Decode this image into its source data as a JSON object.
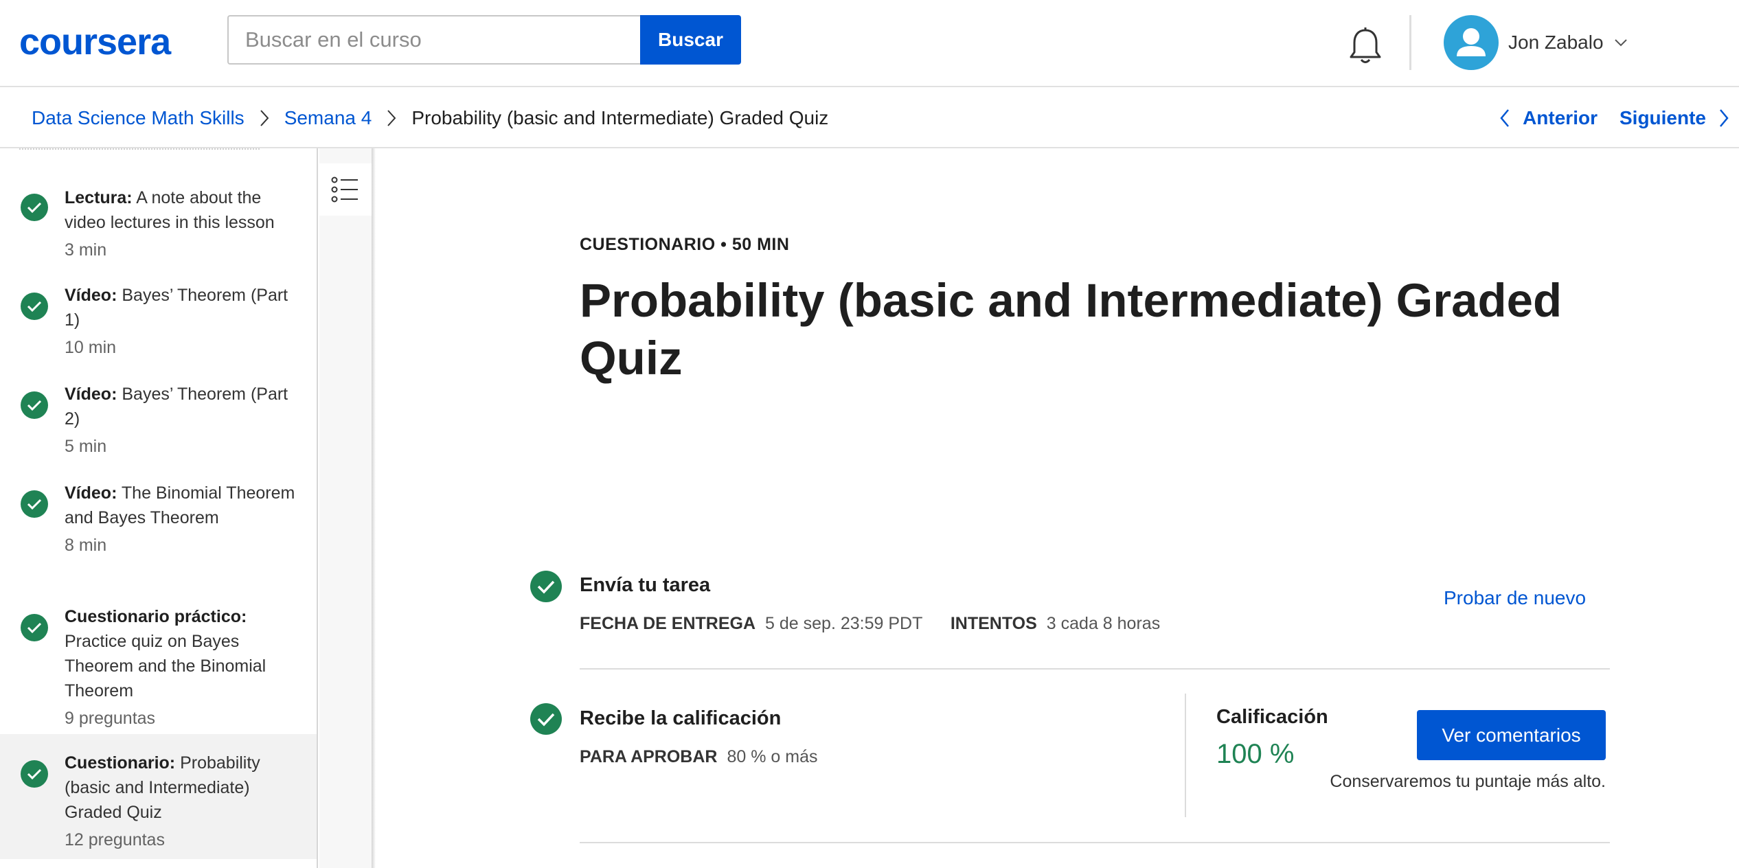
{
  "header": {
    "logo": "coursera",
    "search": {
      "placeholder": "Buscar en el curso",
      "button": "Buscar"
    },
    "user": {
      "name": "Jon Zabalo"
    }
  },
  "breadcrumb": {
    "items": [
      "Data Science Math Skills",
      "Semana 4"
    ],
    "current": "Probability (basic and Intermediate) Graded Quiz",
    "prev": "Anterior",
    "next": "Siguiente"
  },
  "sidebar": {
    "items": [
      {
        "type": "Lectura:",
        "title": "A note about the video lectures in this lesson",
        "meta": "3 min",
        "completed": true
      },
      {
        "type": "Vídeo:",
        "title": "Bayes’ Theorem (Part 1)",
        "meta": "10 min",
        "completed": true
      },
      {
        "type": "Vídeo:",
        "title": "Bayes’ Theorem (Part 2)",
        "meta": "5 min",
        "completed": true
      },
      {
        "type": "Vídeo:",
        "title": "The Binomial Theorem and Bayes Theorem",
        "meta": "8 min",
        "completed": true
      },
      {
        "type": "Cuestionario práctico:",
        "title": "Practice quiz on Bayes Theorem and the Binomial Theorem",
        "meta": "9 preguntas",
        "completed": true
      },
      {
        "type": "Cuestionario:",
        "title": "Probability (basic and Intermediate) Graded Quiz",
        "meta": "12 preguntas",
        "completed": true,
        "active": true
      }
    ]
  },
  "main": {
    "kicker": "CUESTIONARIO • 50 MIN",
    "title": "Probability (basic and Intermediate) Graded Quiz",
    "submit": {
      "title": "Envía tu tarea",
      "due_label": "FECHA DE ENTREGA",
      "due_value": "5 de sep. 23:59 PDT",
      "attempts_label": "INTENTOS",
      "attempts_value": "3 cada 8 horas",
      "retry": "Probar de nuevo"
    },
    "grade": {
      "title": "Recibe la calificación",
      "pass_label": "PARA APROBAR",
      "pass_value": "80 % o más",
      "grade_label": "Calificación",
      "grade_value": "100 %",
      "feedback_button": "Ver comentarios",
      "note": "Conservaremos tu puntaje más alto."
    }
  },
  "colors": {
    "brand": "#0056d2",
    "success": "#1f8354",
    "avatar": "#2ea3d8"
  }
}
